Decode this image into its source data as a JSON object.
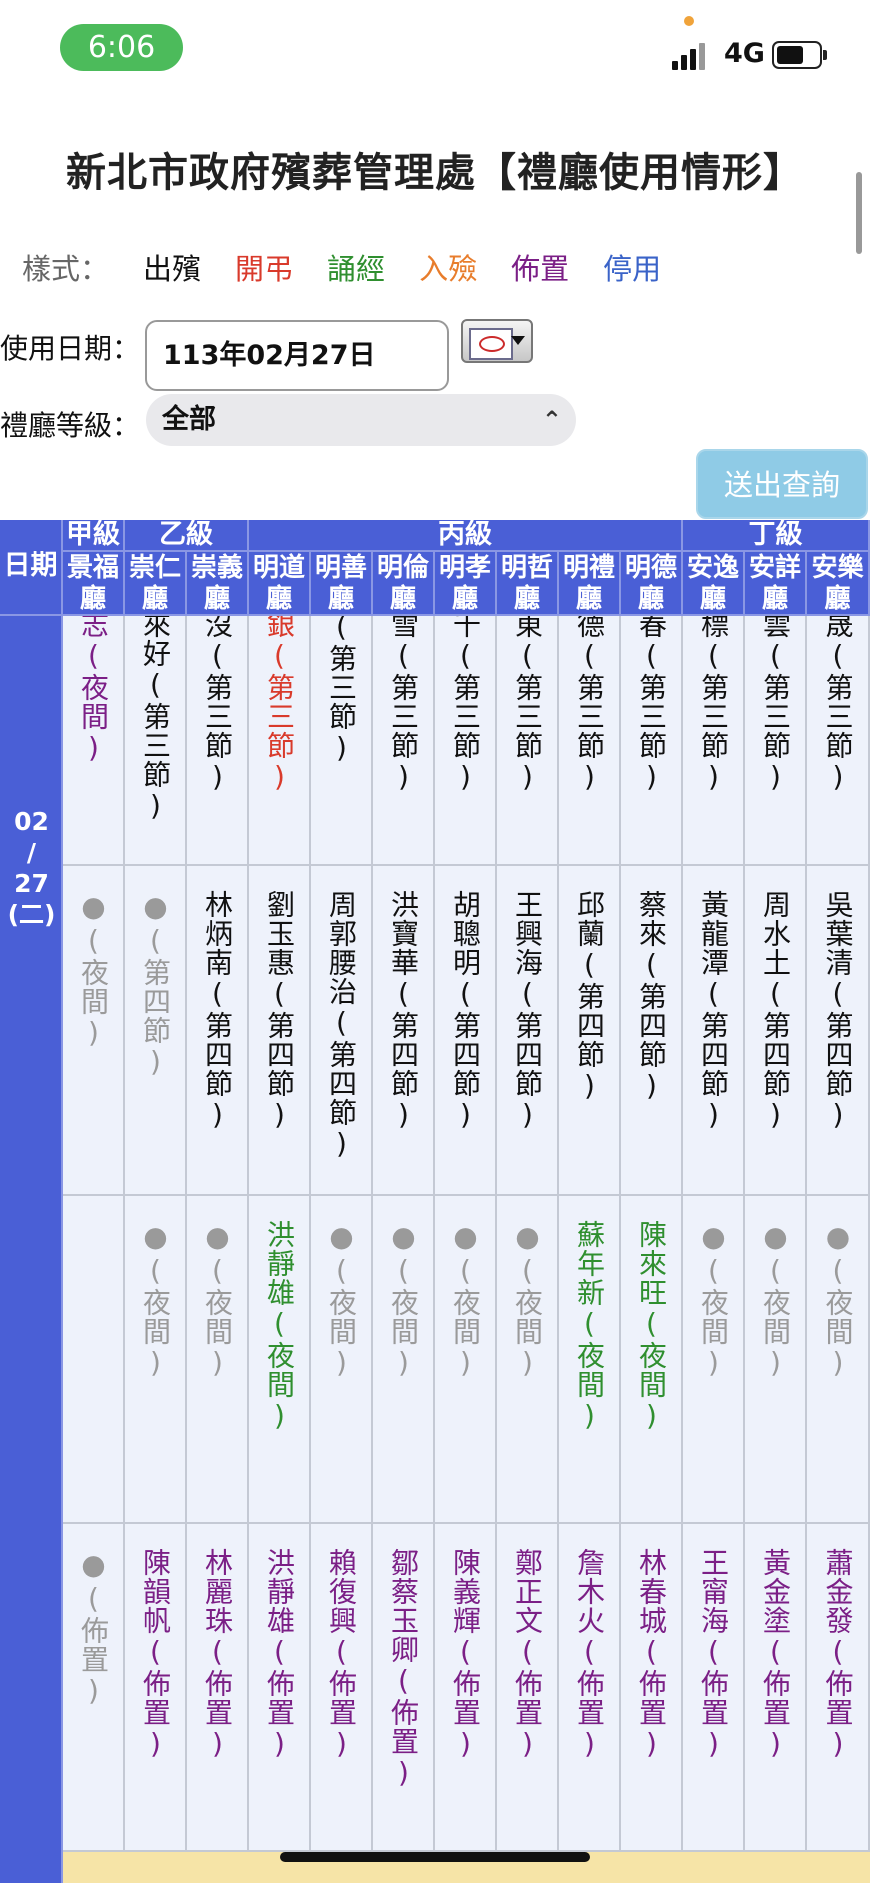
{
  "status_bar": {
    "time": "6:06",
    "network": "4G"
  },
  "page_title": "新北市政府殯葬管理處【禮廳使用情形】",
  "legend": {
    "label": "樣式：",
    "items": [
      {
        "text": "出殯",
        "color": "#111111"
      },
      {
        "text": "開弔",
        "color": "#d93a2b"
      },
      {
        "text": "誦經",
        "color": "#2f8f2f"
      },
      {
        "text": "入殮",
        "color": "#e87d2c"
      },
      {
        "text": "佈置",
        "color": "#7b1f86"
      },
      {
        "text": "停用",
        "color": "#3a63c8"
      }
    ]
  },
  "form": {
    "date_label": "使用日期：",
    "date_value": "113年02月27日",
    "level_label": "禮廳等級：",
    "level_value": "全部",
    "submit_label": "送出查詢"
  },
  "table": {
    "date_header": "日期",
    "date_cell": [
      "02",
      "/",
      "27",
      "(二)"
    ],
    "groups": [
      {
        "name": "甲級",
        "span": 1
      },
      {
        "name": "乙級",
        "span": 2
      },
      {
        "name": "丙級",
        "span": 7
      },
      {
        "name": "丁級",
        "span": 3
      }
    ],
    "halls": [
      "景福廳",
      "崇仁廳",
      "崇義廳",
      "明道廳",
      "明善廳",
      "明倫廳",
      "明孝廳",
      "明哲廳",
      "明禮廳",
      "明德廳",
      "安逸廳",
      "安詳廳",
      "安樂廳"
    ],
    "colors": {
      "purple": "#7b1f86",
      "black": "#111111",
      "red": "#d93a2b",
      "green": "#2f8f2f",
      "gray": "#9a9a9a"
    },
    "rows": [
      [
        "志(夜間)",
        "來好(第三節)",
        "沒(第三節)",
        "銀(第三節)",
        "(第三節)",
        "雪(第三節)",
        "千(第三節)",
        "東(第三節)",
        "德(第三節)",
        "春(第三節)",
        "標(第三節)",
        "雲(第三節)",
        "晟(第三節)"
      ],
      [
        "●(夜間)",
        "●(第四節)",
        "林炳南(第四節)",
        "劉玉惠(第四節)",
        "周郭腰治(第四節)",
        "洪寶華(第四節)",
        "胡聰明(第四節)",
        "王興海(第四節)",
        "邱蘭(第四節)",
        "蔡來(第四節)",
        "黃龍潭(第四節)",
        "周水土(第四節)",
        "吳葉清(第四節)"
      ],
      [
        "",
        "●(夜間)",
        "●(夜間)",
        "洪靜雄(夜間)",
        "●(夜間)",
        "●(夜間)",
        "●(夜間)",
        "●(夜間)",
        "蘇年新(夜間)",
        "陳來旺(夜間)",
        "●(夜間)",
        "●(夜間)",
        "●(夜間)"
      ],
      [
        "●(佈置)",
        "陳韻帆(佈置)",
        "林麗珠(佈置)",
        "洪靜雄(佈置)",
        "賴復興(佈置)",
        "鄒蔡玉卿(佈置)",
        "陳義輝(佈置)",
        "鄭正文(佈置)",
        "詹木火(佈置)",
        "林春城(佈置)",
        "王甯海(佈置)",
        "黃金塗(佈置)",
        "蕭金發(佈置)"
      ]
    ],
    "row_colors": [
      [
        "purple",
        "black",
        "black",
        "red",
        "black",
        "black",
        "black",
        "black",
        "black",
        "black",
        "black",
        "black",
        "black"
      ],
      [
        "gray",
        "gray",
        "black",
        "black",
        "black",
        "black",
        "black",
        "black",
        "black",
        "black",
        "black",
        "black",
        "black"
      ],
      [
        "gray",
        "gray",
        "gray",
        "green",
        "gray",
        "gray",
        "gray",
        "gray",
        "green",
        "green",
        "gray",
        "gray",
        "gray"
      ],
      [
        "gray",
        "purple",
        "purple",
        "purple",
        "purple",
        "purple",
        "purple",
        "purple",
        "purple",
        "purple",
        "purple",
        "purple",
        "purple"
      ]
    ]
  }
}
